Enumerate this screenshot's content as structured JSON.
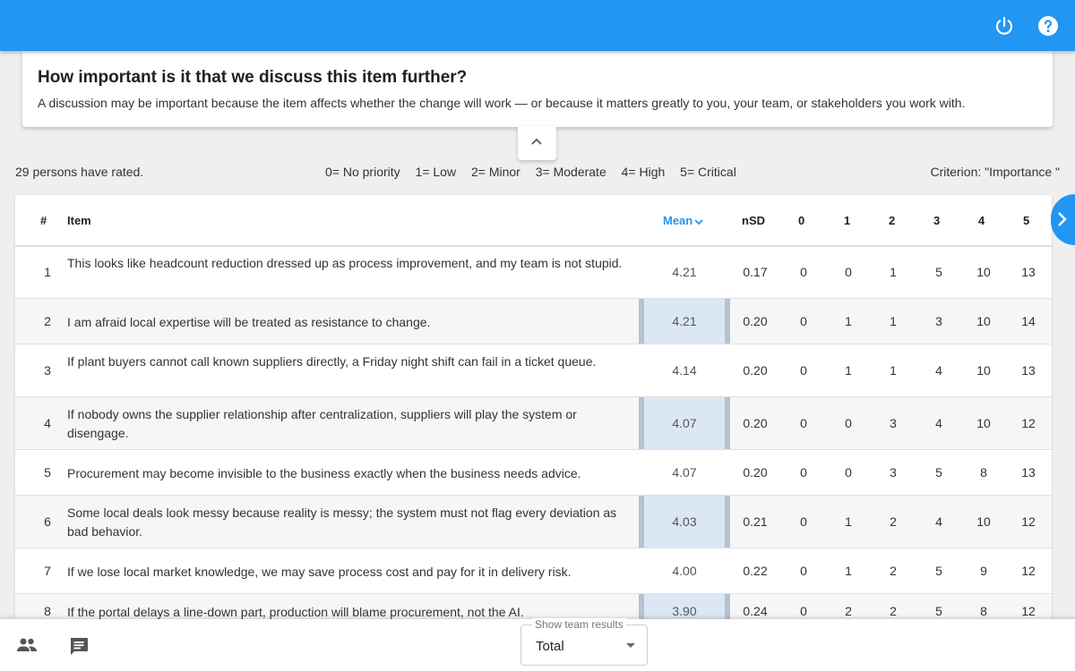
{
  "colors": {
    "accent": "#2196f3",
    "mean_band": "#e3f0fc"
  },
  "topbar": {
    "icons": [
      "power-icon",
      "help-icon"
    ]
  },
  "question": {
    "title": "How important is it that we discuss this item further?",
    "description": "A discussion may be important because the item affects whether the change will work — or because it matters greatly to you, your team, or stakeholders you work with."
  },
  "summary": {
    "rated": "29 persons have rated.",
    "scale": [
      "0= No priority",
      "1= Low",
      "2= Minor",
      "3= Moderate",
      "4= High",
      "5= Critical"
    ],
    "criterion": "Criterion: \"Importance \""
  },
  "table": {
    "headers": {
      "num": "#",
      "item": "Item",
      "mean": "Mean",
      "nsd": "nSD",
      "c0": "0",
      "c1": "1",
      "c2": "2",
      "c3": "3",
      "c4": "4",
      "c5": "5"
    },
    "sort": {
      "column": "Mean",
      "direction": "descending"
    },
    "rows": [
      {
        "num": "1",
        "item": "This looks like headcount reduction dressed up as process improvement, and my team is not stupid.",
        "mean": "4.21",
        "nsd": "0.17",
        "c0": "0",
        "c1": "0",
        "c2": "1",
        "c3": "5",
        "c4": "10",
        "c5": "13"
      },
      {
        "num": "2",
        "item": "I am afraid local expertise will be treated as resistance to change.",
        "mean": "4.21",
        "nsd": "0.20",
        "c0": "0",
        "c1": "1",
        "c2": "1",
        "c3": "3",
        "c4": "10",
        "c5": "14"
      },
      {
        "num": "3",
        "item": "If plant buyers cannot call known suppliers directly, a Friday night shift can fail in a ticket queue.",
        "mean": "4.14",
        "nsd": "0.20",
        "c0": "0",
        "c1": "1",
        "c2": "1",
        "c3": "4",
        "c4": "10",
        "c5": "13"
      },
      {
        "num": "4",
        "item": "If nobody owns the supplier relationship after centralization, suppliers will play the system or disengage.",
        "mean": "4.07",
        "nsd": "0.20",
        "c0": "0",
        "c1": "0",
        "c2": "3",
        "c3": "4",
        "c4": "10",
        "c5": "12"
      },
      {
        "num": "5",
        "item": "Procurement may become invisible to the business exactly when the business needs advice.",
        "mean": "4.07",
        "nsd": "0.20",
        "c0": "0",
        "c1": "0",
        "c2": "3",
        "c3": "5",
        "c4": "8",
        "c5": "13"
      },
      {
        "num": "6",
        "item": "Some local deals look messy because reality is messy; the system must not flag every deviation as bad behavior.",
        "mean": "4.03",
        "nsd": "0.21",
        "c0": "0",
        "c1": "1",
        "c2": "2",
        "c3": "4",
        "c4": "10",
        "c5": "12"
      },
      {
        "num": "7",
        "item": "If we lose local market knowledge, we may save process cost and pay for it in delivery risk.",
        "mean": "4.00",
        "nsd": "0.22",
        "c0": "0",
        "c1": "1",
        "c2": "2",
        "c3": "5",
        "c4": "9",
        "c5": "12"
      },
      {
        "num": "8",
        "item": "If the portal delays a line-down part, production will blame procurement, not the AI.",
        "mean": "3.90",
        "nsd": "0.24",
        "c0": "0",
        "c1": "2",
        "c2": "2",
        "c3": "5",
        "c4": "8",
        "c5": "12"
      }
    ]
  },
  "footer": {
    "icons": [
      "group-icon",
      "comment-icon"
    ],
    "select": {
      "legend": "Show team results",
      "value": "Total"
    }
  }
}
